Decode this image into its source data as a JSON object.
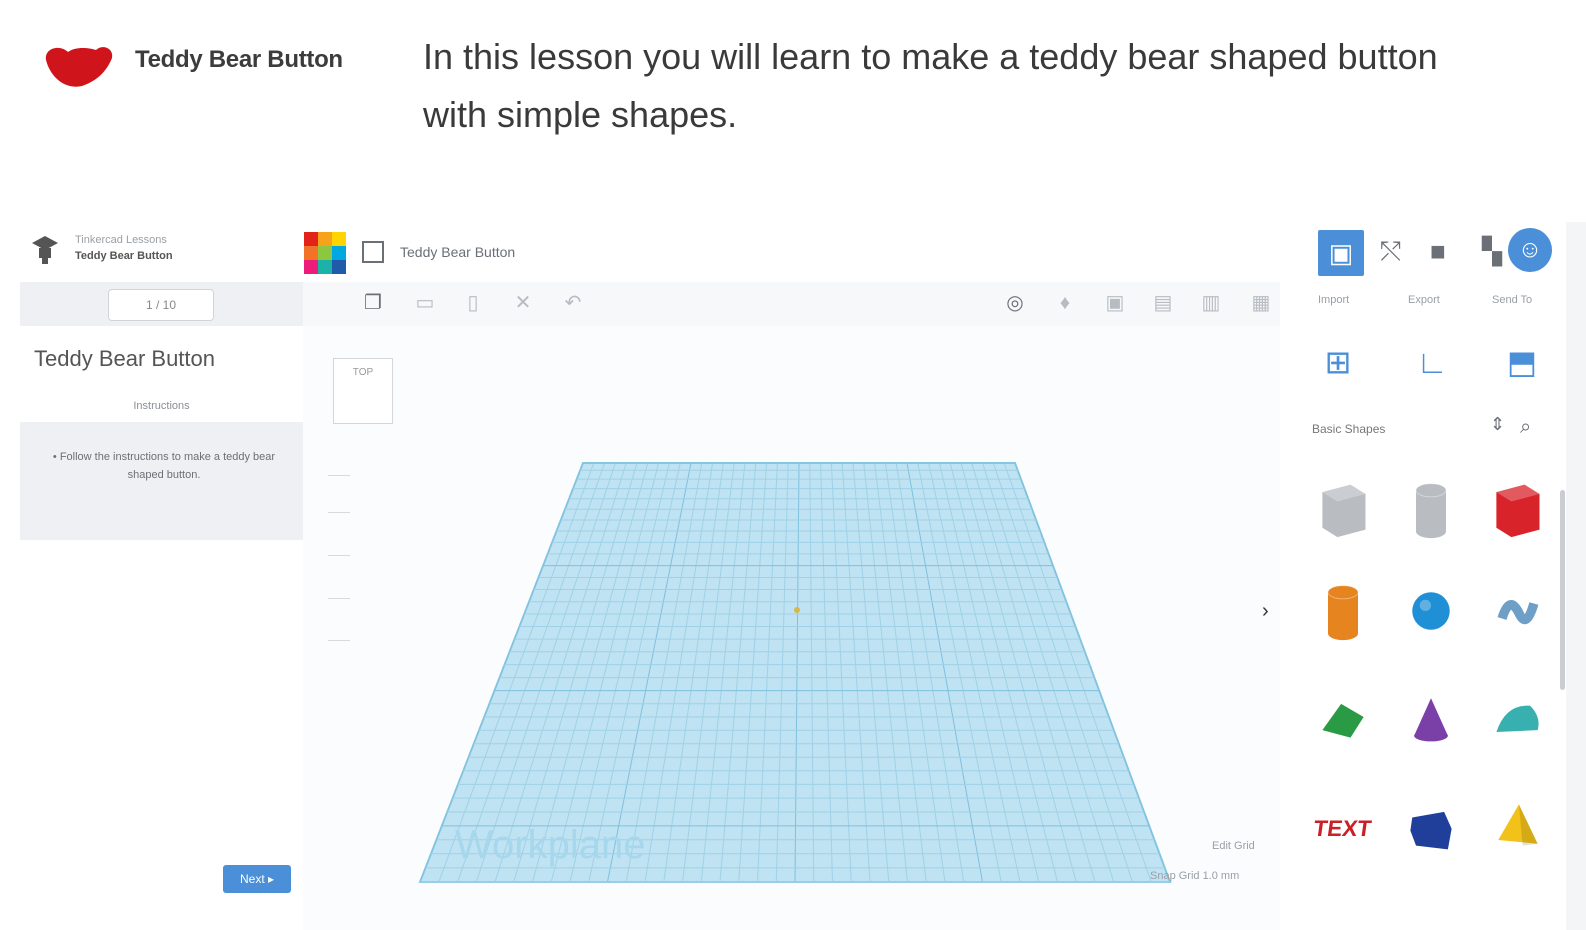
{
  "lesson": {
    "title": "Teddy Bear Button",
    "description": "In this lesson you will learn to make a teddy bear shaped button with simple shapes."
  },
  "left_panel": {
    "logo_line1": "Tinkercad Lessons",
    "logo_line2": "Teddy Bear Button",
    "step_pill": "1 / 10",
    "tutorial_title": "Teddy Bear Button",
    "tutorial_subtitle": "Instructions",
    "tutorial_text": "• Follow the instructions to make a teddy bear shaped button.",
    "next_label": "Next ▸"
  },
  "topbar": {
    "design_name": "Teddy Bear Button"
  },
  "viewcube": {
    "label": "TOP"
  },
  "workspace": {
    "workplane_label": "Workplane",
    "edit_grid": "Edit Grid",
    "snap_grid": "Snap Grid  1.0 mm"
  },
  "right_panel": {
    "tab_labels": [
      "Import",
      "Export",
      "Send To"
    ],
    "shape_category": "Basic Shapes",
    "shapes": [
      {
        "name": "box-hole",
        "color": "#b9bdc2"
      },
      {
        "name": "cylinder-hole",
        "color": "#b9bdc2"
      },
      {
        "name": "box",
        "color": "#d9232a"
      },
      {
        "name": "cylinder",
        "color": "#e6841f"
      },
      {
        "name": "sphere",
        "color": "#1f8fd6"
      },
      {
        "name": "scribble",
        "color": "#6f9fc7"
      },
      {
        "name": "roof",
        "color": "#2a9a45"
      },
      {
        "name": "cone",
        "color": "#7b3fa8"
      },
      {
        "name": "round-roof",
        "color": "#39b0b0"
      },
      {
        "name": "text",
        "color": "#cc1f26"
      },
      {
        "name": "shape-generator",
        "color": "#1f3f9a"
      },
      {
        "name": "pyramid",
        "color": "#f2c21b"
      }
    ]
  },
  "colors": {
    "accent": "#4a8fd8",
    "workplane": "#bfe3f2",
    "workplane_grid": "#8fcbe3"
  }
}
